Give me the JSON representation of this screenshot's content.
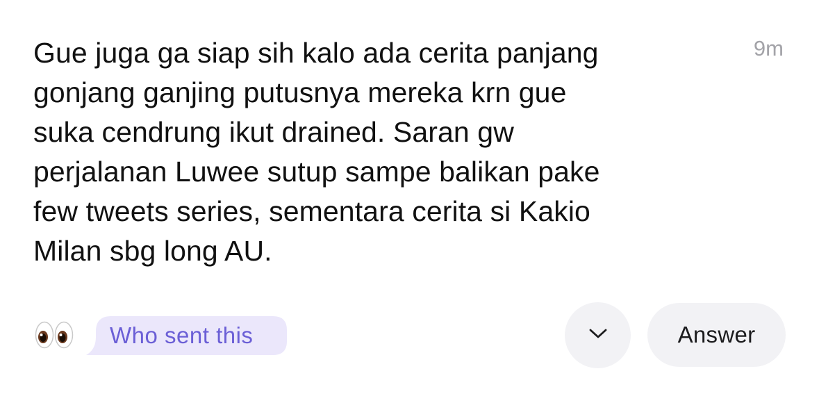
{
  "message": {
    "lines": [
      "Gue juga ga siap sih kalo ada cerita panjang",
      "gonjang ganjing putusnya mereka krn gue",
      "suka cendrung ikut drained. Saran gw",
      "perjalanan Luwee sutup sampe balikan pake",
      "few tweets series, sementara cerita si Kakio",
      "Milan sbg long AU."
    ],
    "timestamp": "9m"
  },
  "footer": {
    "reaction_icon": "eyes-emoji-icon",
    "who_sent_label": "Who sent this",
    "expand_icon": "chevron-down-icon",
    "answer_label": "Answer"
  },
  "colors": {
    "text": "#111111",
    "timestamp": "#a3a3a8",
    "who_sent_bg": "#ebe7fb",
    "who_sent_text": "#6b5fd6",
    "button_bg": "#f2f2f5"
  }
}
